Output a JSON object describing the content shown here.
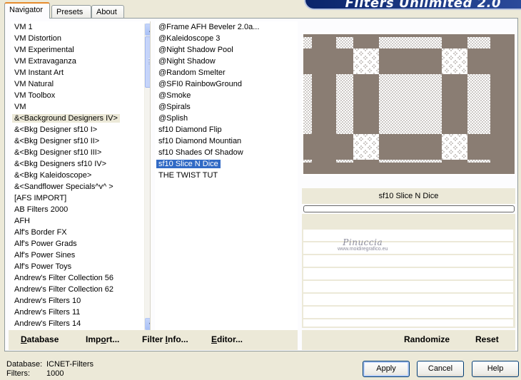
{
  "tabs": [
    {
      "label": "Navigator",
      "active": true
    },
    {
      "label": "Presets",
      "active": false
    },
    {
      "label": "About",
      "active": false
    }
  ],
  "banner": {
    "title": "Filters Unlimited 2.0"
  },
  "categories": {
    "items": [
      "VM 1",
      "VM Distortion",
      "VM Experimental",
      "VM Extravaganza",
      "VM Instant Art",
      "VM Natural",
      "VM Toolbox",
      "VM",
      "&<Background Designers IV>",
      "&<Bkg Designer sf10 I>",
      "&<Bkg Designer sf10 II>",
      "&<Bkg Designer sf10 III>",
      "&<Bkg Designers sf10 IV>",
      "&<Bkg Kaleidoscope>",
      "&<Sandflower Specials^v^ >",
      "[AFS IMPORT]",
      "AB Filters 2000",
      "AFH",
      "Alf's Border FX",
      "Alf's Power Grads",
      "Alf's Power Sines",
      "Alf's Power Toys",
      "Andrew's Filter Collection 56",
      "Andrew's Filter Collection 62",
      "Andrew's Filters 10",
      "Andrew's Filters 11",
      "Andrew's Filters 14"
    ],
    "selected_index": 8
  },
  "filters": {
    "items": [
      "@Frame AFH Beveler 2.0a...",
      "@Kaleidoscope 3",
      "@Night Shadow Pool",
      "@Night Shadow",
      "@Random Smelter",
      "@SFI0 RainbowGround",
      "@Smoke",
      "@Spirals",
      "@Splish",
      "sf10 Diamond Flip",
      "sf10 Diamond Mountian",
      "sf10 Shades Of Shadow",
      "sf10 Slice N Dice",
      "THE TWIST TUT"
    ],
    "selected_index": 12
  },
  "preview": {
    "filter_name": "sf10 Slice N Dice",
    "progress_percent": 0,
    "watermark_big": "Pinuccia",
    "watermark_small": "www.moidiregrafico.eu",
    "colors": {
      "band": "#8a7d73",
      "checker_light": "#ffffff",
      "checker_dark": "#cdc9c6"
    }
  },
  "left_buttons": {
    "database": {
      "pre": "",
      "ul": "D",
      "post": "atabase"
    },
    "import": {
      "pre": "Imp",
      "ul": "o",
      "post": "rt..."
    },
    "filter_info": {
      "pre": "Filter ",
      "ul": "I",
      "post": "nfo..."
    },
    "editor": {
      "pre": "",
      "ul": "E",
      "post": "ditor..."
    }
  },
  "right_buttons": {
    "randomize": "Randomize",
    "reset": "Reset"
  },
  "footer": {
    "database_label": "Database:",
    "database_value": "ICNET-Filters",
    "filters_label": "Filters:",
    "filters_value": "1000"
  },
  "dialog_buttons": {
    "apply": "Apply",
    "cancel": "Cancel",
    "help": "Help"
  }
}
